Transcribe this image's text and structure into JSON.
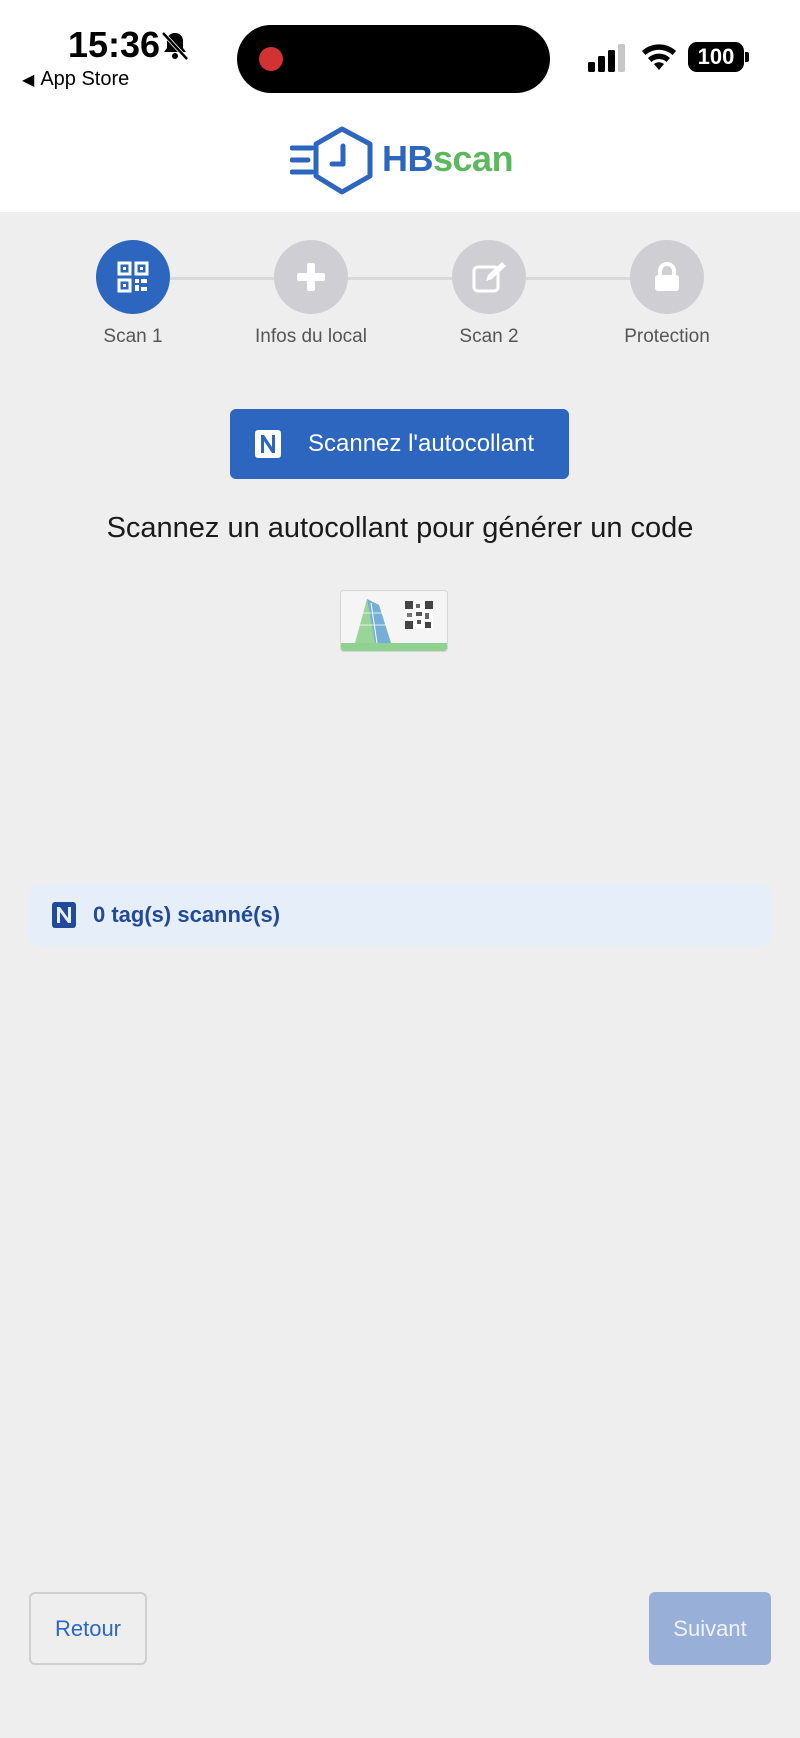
{
  "status_bar": {
    "time": "15:36",
    "back_app": "App Store",
    "battery": "100"
  },
  "header": {
    "logo_hb": "HB",
    "logo_scan": "scan"
  },
  "stepper": {
    "steps": [
      {
        "label": "Scan 1",
        "icon": "qrcode-icon",
        "active": true
      },
      {
        "label": "Infos du local",
        "icon": "plus-icon",
        "active": false
      },
      {
        "label": "Scan 2",
        "icon": "edit-icon",
        "active": false
      },
      {
        "label": "Protection",
        "icon": "lock-icon",
        "active": false
      }
    ]
  },
  "main": {
    "scan_button_label": "Scannez l'autocollant",
    "instruction": "Scannez un autocollant pour générer un code",
    "tag_count_text": "0 tag(s) scanné(s)"
  },
  "footer": {
    "back_label": "Retour",
    "next_label": "Suivant"
  },
  "colors": {
    "primary": "#2d66be",
    "accent_green": "#5cb85c",
    "background": "#eeeeee",
    "banner_bg": "#e6eff9",
    "disabled_button": "#98b0d8"
  }
}
